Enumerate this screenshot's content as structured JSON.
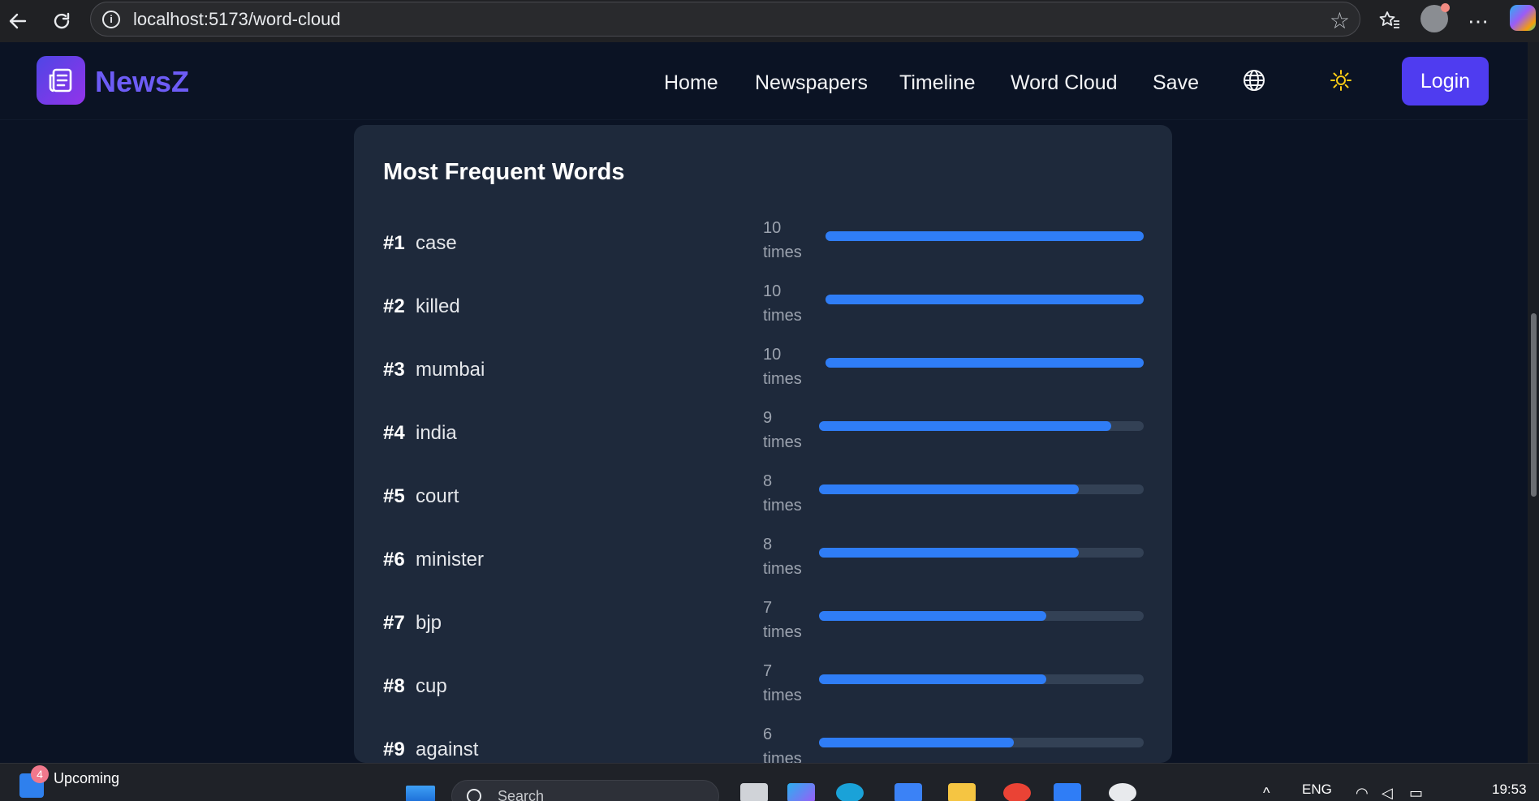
{
  "browser": {
    "url": "localhost:5173/word-cloud",
    "icons": [
      "back-arrow-icon",
      "reload-icon",
      "site-info-icon",
      "favorite-star-icon",
      "favorites-icon",
      "profile-avatar",
      "more-icon",
      "copilot-icon"
    ]
  },
  "header": {
    "logo_text": "NewsZ",
    "nav": [
      "Home",
      "Newspapers",
      "Timeline",
      "Word Cloud",
      "Save"
    ],
    "login_label": "Login",
    "icons": [
      "newspaper-icon",
      "globe-icon",
      "sun-icon"
    ]
  },
  "card": {
    "title": "Most Frequent Words",
    "max_count": 10,
    "times_label": "times",
    "words": [
      {
        "rank": "#1",
        "word": "case",
        "count": "10"
      },
      {
        "rank": "#2",
        "word": "killed",
        "count": "10"
      },
      {
        "rank": "#3",
        "word": "mumbai",
        "count": "10"
      },
      {
        "rank": "#4",
        "word": "india",
        "count": "9"
      },
      {
        "rank": "#5",
        "word": "court",
        "count": "8"
      },
      {
        "rank": "#6",
        "word": "minister",
        "count": "8"
      },
      {
        "rank": "#7",
        "word": "bjp",
        "count": "7"
      },
      {
        "rank": "#8",
        "word": "cup",
        "count": "7"
      },
      {
        "rank": "#9",
        "word": "against",
        "count": "6"
      }
    ]
  },
  "taskbar": {
    "upcoming_label": "Upcoming",
    "badge_count": "4",
    "search_placeholder": "Search",
    "language": "ENG",
    "time": "19:53"
  },
  "colors": {
    "bar_fill": "#2f7df6",
    "bar_track": "#334155",
    "card_bg": "#1e293b",
    "page_bg": "#0b1324",
    "login_bg": "#4f3cf0"
  }
}
